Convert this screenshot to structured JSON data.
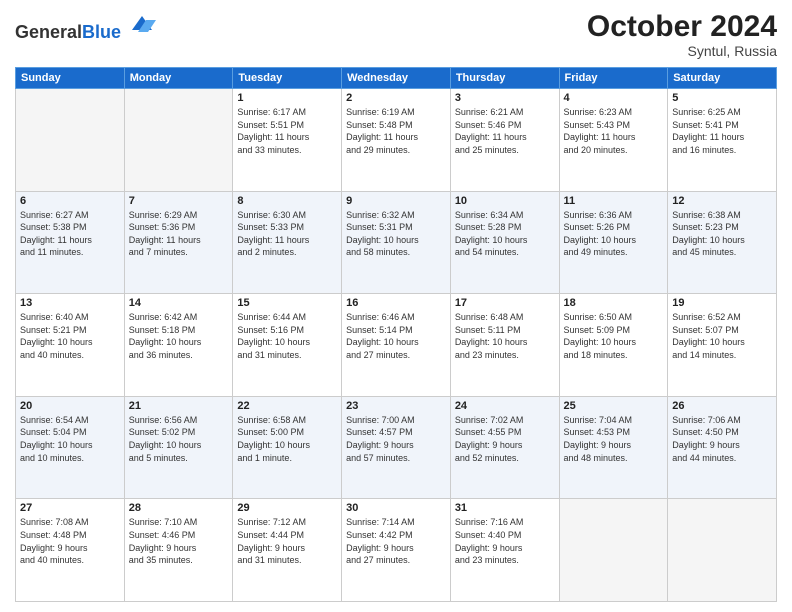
{
  "header": {
    "logo_general": "General",
    "logo_blue": "Blue",
    "month": "October 2024",
    "location": "Syntul, Russia"
  },
  "days_header": [
    "Sunday",
    "Monday",
    "Tuesday",
    "Wednesday",
    "Thursday",
    "Friday",
    "Saturday"
  ],
  "weeks": [
    {
      "shade": "row-white",
      "days": [
        {
          "num": "",
          "info": ""
        },
        {
          "num": "",
          "info": ""
        },
        {
          "num": "1",
          "info": "Sunrise: 6:17 AM\nSunset: 5:51 PM\nDaylight: 11 hours\nand 33 minutes."
        },
        {
          "num": "2",
          "info": "Sunrise: 6:19 AM\nSunset: 5:48 PM\nDaylight: 11 hours\nand 29 minutes."
        },
        {
          "num": "3",
          "info": "Sunrise: 6:21 AM\nSunset: 5:46 PM\nDaylight: 11 hours\nand 25 minutes."
        },
        {
          "num": "4",
          "info": "Sunrise: 6:23 AM\nSunset: 5:43 PM\nDaylight: 11 hours\nand 20 minutes."
        },
        {
          "num": "5",
          "info": "Sunrise: 6:25 AM\nSunset: 5:41 PM\nDaylight: 11 hours\nand 16 minutes."
        }
      ]
    },
    {
      "shade": "row-shade",
      "days": [
        {
          "num": "6",
          "info": "Sunrise: 6:27 AM\nSunset: 5:38 PM\nDaylight: 11 hours\nand 11 minutes."
        },
        {
          "num": "7",
          "info": "Sunrise: 6:29 AM\nSunset: 5:36 PM\nDaylight: 11 hours\nand 7 minutes."
        },
        {
          "num": "8",
          "info": "Sunrise: 6:30 AM\nSunset: 5:33 PM\nDaylight: 11 hours\nand 2 minutes."
        },
        {
          "num": "9",
          "info": "Sunrise: 6:32 AM\nSunset: 5:31 PM\nDaylight: 10 hours\nand 58 minutes."
        },
        {
          "num": "10",
          "info": "Sunrise: 6:34 AM\nSunset: 5:28 PM\nDaylight: 10 hours\nand 54 minutes."
        },
        {
          "num": "11",
          "info": "Sunrise: 6:36 AM\nSunset: 5:26 PM\nDaylight: 10 hours\nand 49 minutes."
        },
        {
          "num": "12",
          "info": "Sunrise: 6:38 AM\nSunset: 5:23 PM\nDaylight: 10 hours\nand 45 minutes."
        }
      ]
    },
    {
      "shade": "row-white",
      "days": [
        {
          "num": "13",
          "info": "Sunrise: 6:40 AM\nSunset: 5:21 PM\nDaylight: 10 hours\nand 40 minutes."
        },
        {
          "num": "14",
          "info": "Sunrise: 6:42 AM\nSunset: 5:18 PM\nDaylight: 10 hours\nand 36 minutes."
        },
        {
          "num": "15",
          "info": "Sunrise: 6:44 AM\nSunset: 5:16 PM\nDaylight: 10 hours\nand 31 minutes."
        },
        {
          "num": "16",
          "info": "Sunrise: 6:46 AM\nSunset: 5:14 PM\nDaylight: 10 hours\nand 27 minutes."
        },
        {
          "num": "17",
          "info": "Sunrise: 6:48 AM\nSunset: 5:11 PM\nDaylight: 10 hours\nand 23 minutes."
        },
        {
          "num": "18",
          "info": "Sunrise: 6:50 AM\nSunset: 5:09 PM\nDaylight: 10 hours\nand 18 minutes."
        },
        {
          "num": "19",
          "info": "Sunrise: 6:52 AM\nSunset: 5:07 PM\nDaylight: 10 hours\nand 14 minutes."
        }
      ]
    },
    {
      "shade": "row-shade",
      "days": [
        {
          "num": "20",
          "info": "Sunrise: 6:54 AM\nSunset: 5:04 PM\nDaylight: 10 hours\nand 10 minutes."
        },
        {
          "num": "21",
          "info": "Sunrise: 6:56 AM\nSunset: 5:02 PM\nDaylight: 10 hours\nand 5 minutes."
        },
        {
          "num": "22",
          "info": "Sunrise: 6:58 AM\nSunset: 5:00 PM\nDaylight: 10 hours\nand 1 minute."
        },
        {
          "num": "23",
          "info": "Sunrise: 7:00 AM\nSunset: 4:57 PM\nDaylight: 9 hours\nand 57 minutes."
        },
        {
          "num": "24",
          "info": "Sunrise: 7:02 AM\nSunset: 4:55 PM\nDaylight: 9 hours\nand 52 minutes."
        },
        {
          "num": "25",
          "info": "Sunrise: 7:04 AM\nSunset: 4:53 PM\nDaylight: 9 hours\nand 48 minutes."
        },
        {
          "num": "26",
          "info": "Sunrise: 7:06 AM\nSunset: 4:50 PM\nDaylight: 9 hours\nand 44 minutes."
        }
      ]
    },
    {
      "shade": "row-white",
      "days": [
        {
          "num": "27",
          "info": "Sunrise: 7:08 AM\nSunset: 4:48 PM\nDaylight: 9 hours\nand 40 minutes."
        },
        {
          "num": "28",
          "info": "Sunrise: 7:10 AM\nSunset: 4:46 PM\nDaylight: 9 hours\nand 35 minutes."
        },
        {
          "num": "29",
          "info": "Sunrise: 7:12 AM\nSunset: 4:44 PM\nDaylight: 9 hours\nand 31 minutes."
        },
        {
          "num": "30",
          "info": "Sunrise: 7:14 AM\nSunset: 4:42 PM\nDaylight: 9 hours\nand 27 minutes."
        },
        {
          "num": "31",
          "info": "Sunrise: 7:16 AM\nSunset: 4:40 PM\nDaylight: 9 hours\nand 23 minutes."
        },
        {
          "num": "",
          "info": ""
        },
        {
          "num": "",
          "info": ""
        }
      ]
    }
  ]
}
